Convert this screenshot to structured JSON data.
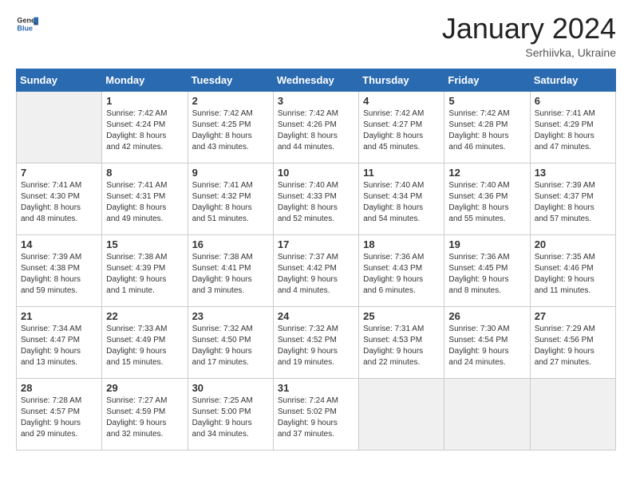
{
  "header": {
    "logo_general": "General",
    "logo_blue": "Blue",
    "month_title": "January 2024",
    "subtitle": "Serhiivka, Ukraine"
  },
  "weekdays": [
    "Sunday",
    "Monday",
    "Tuesday",
    "Wednesday",
    "Thursday",
    "Friday",
    "Saturday"
  ],
  "weeks": [
    [
      {
        "day": "",
        "text": ""
      },
      {
        "day": "1",
        "text": "Sunrise: 7:42 AM\nSunset: 4:24 PM\nDaylight: 8 hours\nand 42 minutes."
      },
      {
        "day": "2",
        "text": "Sunrise: 7:42 AM\nSunset: 4:25 PM\nDaylight: 8 hours\nand 43 minutes."
      },
      {
        "day": "3",
        "text": "Sunrise: 7:42 AM\nSunset: 4:26 PM\nDaylight: 8 hours\nand 44 minutes."
      },
      {
        "day": "4",
        "text": "Sunrise: 7:42 AM\nSunset: 4:27 PM\nDaylight: 8 hours\nand 45 minutes."
      },
      {
        "day": "5",
        "text": "Sunrise: 7:42 AM\nSunset: 4:28 PM\nDaylight: 8 hours\nand 46 minutes."
      },
      {
        "day": "6",
        "text": "Sunrise: 7:41 AM\nSunset: 4:29 PM\nDaylight: 8 hours\nand 47 minutes."
      }
    ],
    [
      {
        "day": "7",
        "text": "Sunrise: 7:41 AM\nSunset: 4:30 PM\nDaylight: 8 hours\nand 48 minutes."
      },
      {
        "day": "8",
        "text": "Sunrise: 7:41 AM\nSunset: 4:31 PM\nDaylight: 8 hours\nand 49 minutes."
      },
      {
        "day": "9",
        "text": "Sunrise: 7:41 AM\nSunset: 4:32 PM\nDaylight: 8 hours\nand 51 minutes."
      },
      {
        "day": "10",
        "text": "Sunrise: 7:40 AM\nSunset: 4:33 PM\nDaylight: 8 hours\nand 52 minutes."
      },
      {
        "day": "11",
        "text": "Sunrise: 7:40 AM\nSunset: 4:34 PM\nDaylight: 8 hours\nand 54 minutes."
      },
      {
        "day": "12",
        "text": "Sunrise: 7:40 AM\nSunset: 4:36 PM\nDaylight: 8 hours\nand 55 minutes."
      },
      {
        "day": "13",
        "text": "Sunrise: 7:39 AM\nSunset: 4:37 PM\nDaylight: 8 hours\nand 57 minutes."
      }
    ],
    [
      {
        "day": "14",
        "text": "Sunrise: 7:39 AM\nSunset: 4:38 PM\nDaylight: 8 hours\nand 59 minutes."
      },
      {
        "day": "15",
        "text": "Sunrise: 7:38 AM\nSunset: 4:39 PM\nDaylight: 9 hours\nand 1 minute."
      },
      {
        "day": "16",
        "text": "Sunrise: 7:38 AM\nSunset: 4:41 PM\nDaylight: 9 hours\nand 3 minutes."
      },
      {
        "day": "17",
        "text": "Sunrise: 7:37 AM\nSunset: 4:42 PM\nDaylight: 9 hours\nand 4 minutes."
      },
      {
        "day": "18",
        "text": "Sunrise: 7:36 AM\nSunset: 4:43 PM\nDaylight: 9 hours\nand 6 minutes."
      },
      {
        "day": "19",
        "text": "Sunrise: 7:36 AM\nSunset: 4:45 PM\nDaylight: 9 hours\nand 8 minutes."
      },
      {
        "day": "20",
        "text": "Sunrise: 7:35 AM\nSunset: 4:46 PM\nDaylight: 9 hours\nand 11 minutes."
      }
    ],
    [
      {
        "day": "21",
        "text": "Sunrise: 7:34 AM\nSunset: 4:47 PM\nDaylight: 9 hours\nand 13 minutes."
      },
      {
        "day": "22",
        "text": "Sunrise: 7:33 AM\nSunset: 4:49 PM\nDaylight: 9 hours\nand 15 minutes."
      },
      {
        "day": "23",
        "text": "Sunrise: 7:32 AM\nSunset: 4:50 PM\nDaylight: 9 hours\nand 17 minutes."
      },
      {
        "day": "24",
        "text": "Sunrise: 7:32 AM\nSunset: 4:52 PM\nDaylight: 9 hours\nand 19 minutes."
      },
      {
        "day": "25",
        "text": "Sunrise: 7:31 AM\nSunset: 4:53 PM\nDaylight: 9 hours\nand 22 minutes."
      },
      {
        "day": "26",
        "text": "Sunrise: 7:30 AM\nSunset: 4:54 PM\nDaylight: 9 hours\nand 24 minutes."
      },
      {
        "day": "27",
        "text": "Sunrise: 7:29 AM\nSunset: 4:56 PM\nDaylight: 9 hours\nand 27 minutes."
      }
    ],
    [
      {
        "day": "28",
        "text": "Sunrise: 7:28 AM\nSunset: 4:57 PM\nDaylight: 9 hours\nand 29 minutes."
      },
      {
        "day": "29",
        "text": "Sunrise: 7:27 AM\nSunset: 4:59 PM\nDaylight: 9 hours\nand 32 minutes."
      },
      {
        "day": "30",
        "text": "Sunrise: 7:25 AM\nSunset: 5:00 PM\nDaylight: 9 hours\nand 34 minutes."
      },
      {
        "day": "31",
        "text": "Sunrise: 7:24 AM\nSunset: 5:02 PM\nDaylight: 9 hours\nand 37 minutes."
      },
      {
        "day": "",
        "text": ""
      },
      {
        "day": "",
        "text": ""
      },
      {
        "day": "",
        "text": ""
      }
    ]
  ]
}
